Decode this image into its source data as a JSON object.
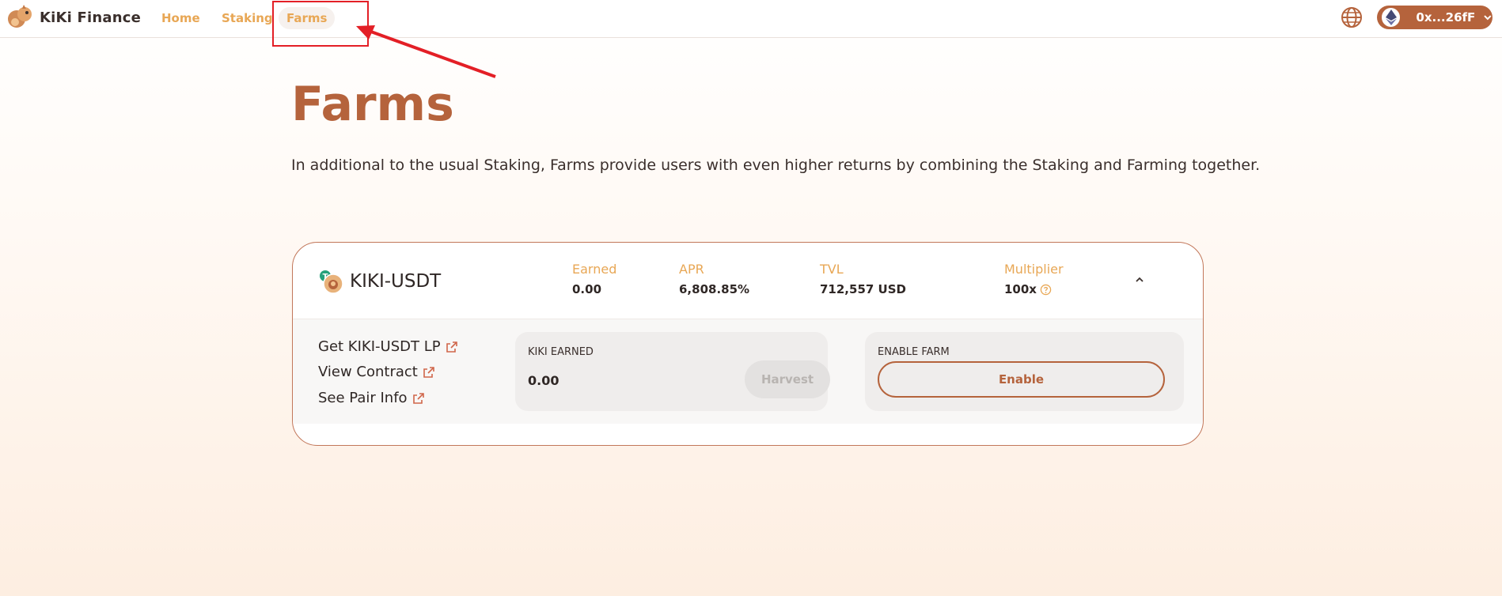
{
  "header": {
    "logo_text": "KiKi Finance",
    "nav": [
      {
        "label": "Home"
      },
      {
        "label": "Staking"
      },
      {
        "label": "Farms"
      }
    ],
    "wallet_address": "0x...26fF",
    "language_icon": "globe-icon",
    "network_icon": "ethereum-icon"
  },
  "page": {
    "title": "Farms",
    "description": "In additional to the usual Staking, Farms provide users with even higher returns by combining the Staking and Farming together."
  },
  "farm": {
    "pair_name": "KIKI-USDT",
    "stats": {
      "earned_label": "Earned",
      "earned_value": "0.00",
      "apr_label": "APR",
      "apr_value": "6,808.85%",
      "tvl_label": "TVL",
      "tvl_value": "712,557 USD",
      "multiplier_label": "Multiplier",
      "multiplier_value": "100x"
    },
    "links": [
      {
        "label": "Get KIKI-USDT LP"
      },
      {
        "label": "View Contract"
      },
      {
        "label": "See Pair Info"
      }
    ],
    "earned_panel": {
      "label": "KIKI EARNED",
      "value": "0.00",
      "button_label": "Harvest"
    },
    "enable_panel": {
      "label": "ENABLE FARM",
      "button_label": "Enable"
    }
  },
  "colors": {
    "brand": "#b5633c",
    "accent": "#e8a755",
    "annotation": "#e31f26"
  }
}
